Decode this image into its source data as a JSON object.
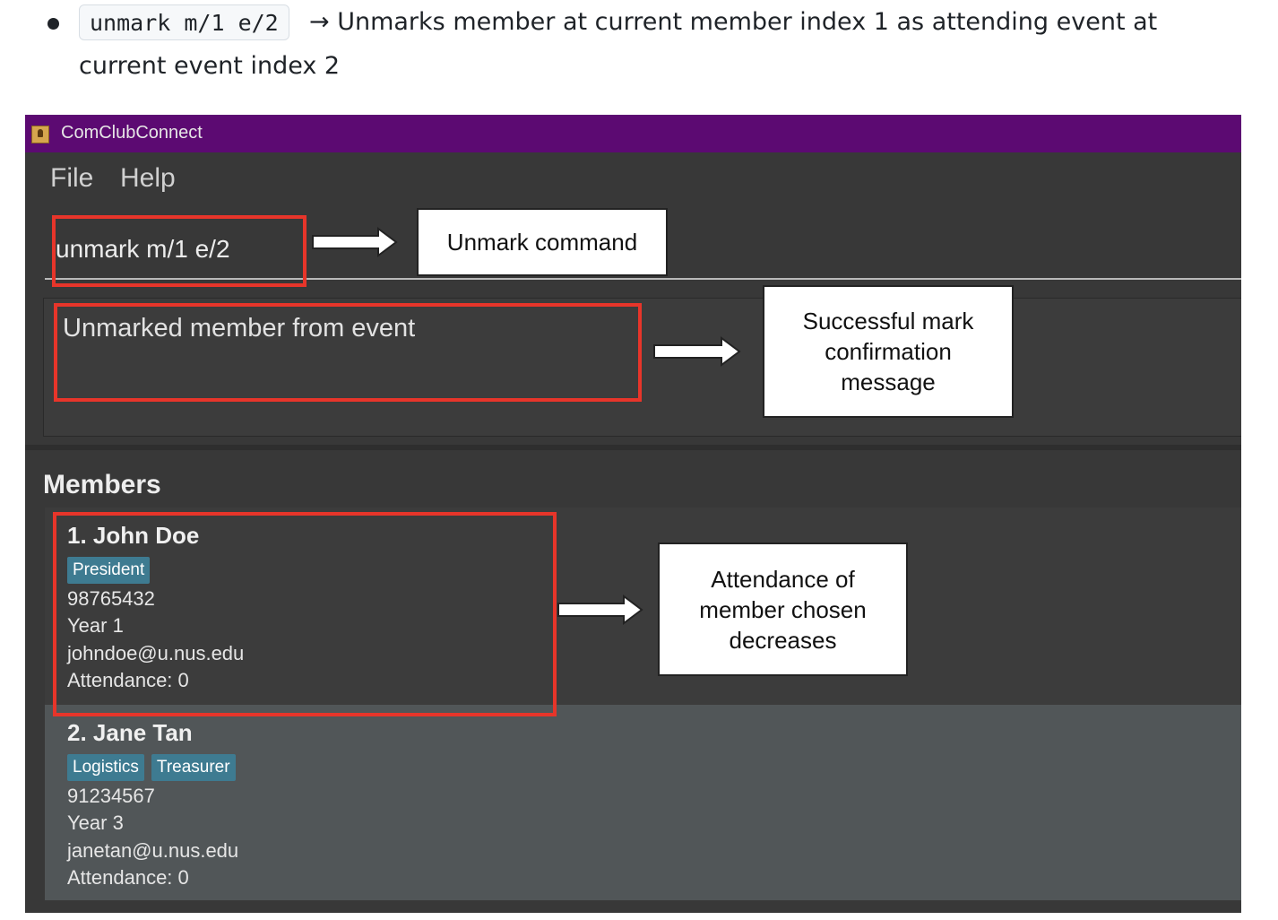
{
  "doc": {
    "code": "unmark m/1 e/2",
    "description_line1": "→ Unmarks member at current member index 1 as attending event at",
    "description_line2": "current event index 2"
  },
  "window": {
    "title": "ComClubConnect",
    "titlebar_color": "#5c0a72"
  },
  "menu": {
    "file": "File",
    "help": "Help"
  },
  "command": {
    "value": "unmark m/1 e/2"
  },
  "result": {
    "message": "Unmarked member from event"
  },
  "members": {
    "heading": "Members",
    "list": [
      {
        "name": "1. John Doe",
        "tags": [
          "President"
        ],
        "phone": "98765432",
        "year": "Year 1",
        "email": "johndoe@u.nus.edu",
        "attendance": "Attendance: 0"
      },
      {
        "name": "2. Jane Tan",
        "tags": [
          "Logistics",
          "Treasurer"
        ],
        "phone": "91234567",
        "year": "Year 3",
        "email": "janetan@u.nus.edu",
        "attendance": "Attendance: 0"
      }
    ]
  },
  "annotations": {
    "command_label": "Unmark command",
    "message_label": [
      "Successful mark",
      "confirmation",
      "message"
    ],
    "attendance_label": [
      "Attendance of",
      "member chosen",
      "decreases"
    ],
    "highlight_color": "#e7352a"
  }
}
